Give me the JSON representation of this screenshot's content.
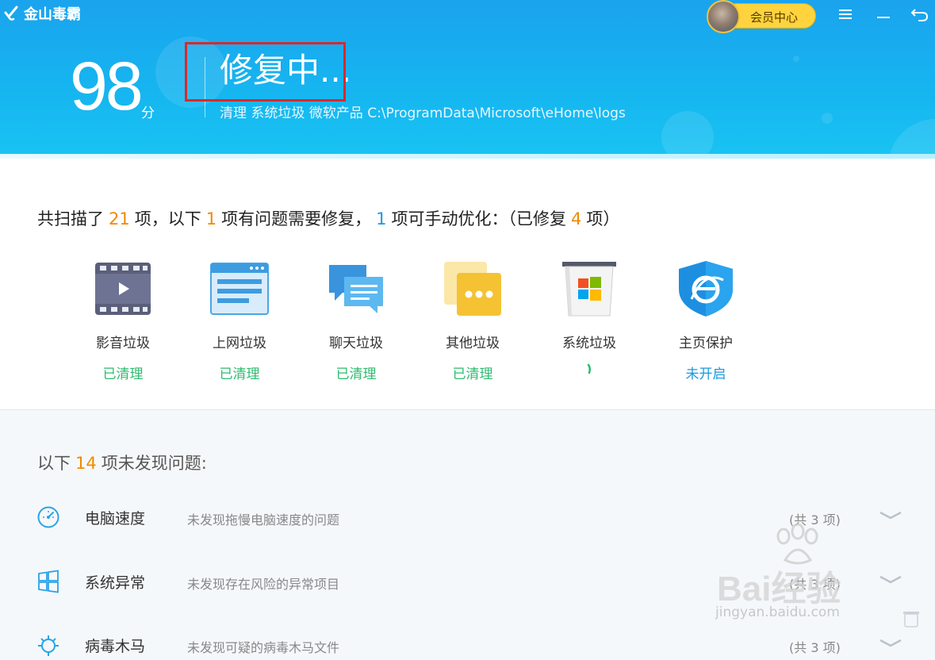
{
  "window": {
    "app_name": "金山毒霸",
    "vip_label": "会员中心"
  },
  "header": {
    "score": "98",
    "score_unit": "分",
    "status": "修复中...",
    "current_path": "清理 系统垃圾 微软产品 C:\\ProgramData\\Microsoft\\eHome\\logs"
  },
  "summary": {
    "part1": "共扫描了",
    "scanned": "21",
    "part2": "项，以下",
    "problems": "1",
    "part3": "项有问题需要修复，",
    "manual": "1",
    "part4": "项可手动优化：（已修复",
    "fixed": "4",
    "part5": "项）"
  },
  "tiles": [
    {
      "name": "影音垃圾",
      "status": "已清理",
      "icon": "video-film-icon"
    },
    {
      "name": "上网垃圾",
      "status": "已清理",
      "icon": "browser-window-icon"
    },
    {
      "name": "聊天垃圾",
      "status": "已清理",
      "icon": "chat-bubbles-icon"
    },
    {
      "name": "其他垃圾",
      "status": "已清理",
      "icon": "other-dots-icon"
    },
    {
      "name": "系统垃圾",
      "status": "",
      "icon": "windows-trash-icon"
    },
    {
      "name": "主页保护",
      "status": "未开启",
      "icon": "ie-shield-icon"
    }
  ],
  "ok_section": {
    "prefix": "以下",
    "count": "14",
    "suffix": "项未发现问题:"
  },
  "rows": [
    {
      "title": "电脑速度",
      "desc": "未发现拖慢电脑速度的问题",
      "count": "(共 3 项)",
      "icon": "speedometer-icon"
    },
    {
      "title": "系统异常",
      "desc": "未发现存在风险的异常项目",
      "count": "(共 3 项)",
      "icon": "windows-logo-icon"
    },
    {
      "title": "病毒木马",
      "desc": "未发现可疑的病毒木马文件",
      "count": "(共 3 项)",
      "icon": "virus-icon"
    }
  ],
  "watermark": {
    "brand": "Bai经验",
    "url": "jingyan.baidu.com"
  },
  "colors": {
    "header_blue": "#1aa3ee",
    "cleaned_green": "#2dbb6f",
    "number_orange": "#f08a00",
    "accent_blue": "#1a9ae0",
    "highlight_red": "#d9292c"
  }
}
